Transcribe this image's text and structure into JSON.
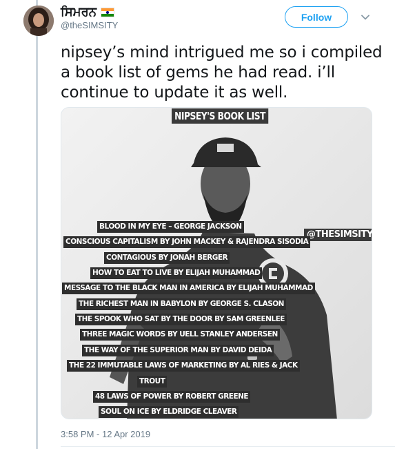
{
  "author": {
    "display_name": "ਸਿਮਰਨ",
    "handle": "@theSIMSITY",
    "flag_icon": "india-flag-icon"
  },
  "header": {
    "follow_label": "Follow",
    "menu_icon": "chevron-down-icon"
  },
  "tweet": {
    "text": "nipsey’s mind intrigued me so i compiled a book list of gems he had read. i’ll continue to update it as well.",
    "timestamp": "3:58 PM - 12 Apr 2019"
  },
  "image": {
    "title": "NIPSEY'S BOOK LIST",
    "watermark": "@THESIMSITY",
    "books": [
      "BLOOD IN MY EYE – GEORGE JACKSON",
      "CONSCIOUS CAPITALISM BY JOHN MACKEY & RAJENDRA SISODIA",
      "CONTAGIOUS BY JONAH BERGER",
      "HOW TO EAT TO LIVE BY ELIJAH MUHAMMAD",
      "MESSAGE TO THE BLACK MAN IN AMERICA BY ELIJAH MUHAMMAD",
      "THE RICHEST MAN IN BABYLON BY GEORGE S. CLASON",
      "THE SPOOK WHO SAT BY THE DOOR BY SAM GREENLEE",
      "THREE MAGIC WORDS BY UELL STANLEY ANDERSEN",
      "THE WAY OF THE SUPERIOR MAN BY DAVID DEIDA",
      "THE 22 IMMUTABLE LAWS OF MARKETING BY AL RIES & JACK",
      "TROUT",
      "48 LAWS OF POWER BY ROBERT GREENE",
      "SOUL ON ICE BY ELDRIDGE CLEAVER"
    ]
  },
  "colors": {
    "accent": "#1da1f2",
    "muted_text": "#657786",
    "thread_line": "#ccd6dd"
  }
}
